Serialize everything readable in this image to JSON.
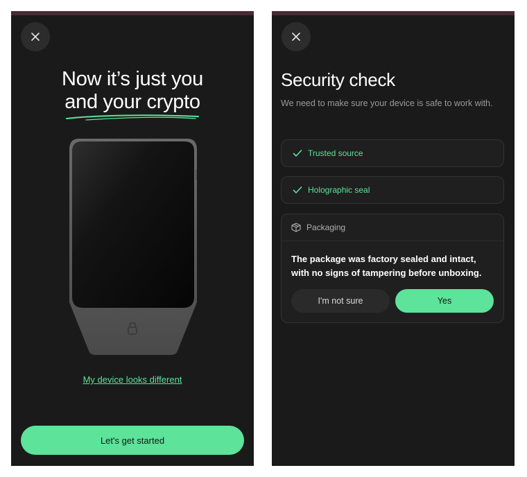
{
  "colors": {
    "accent": "#5de39a",
    "background": "#1a1a1a",
    "card": "#1f1f1f"
  },
  "welcome_screen": {
    "close_icon": "close-icon",
    "title_line1": "Now it’s just you",
    "title_line2": "and your crypto",
    "device_icon": "lock-icon",
    "link_label": "My device looks different",
    "primary_button_label": "Let's get started"
  },
  "security_screen": {
    "close_icon": "close-icon",
    "title": "Security check",
    "subtitle": "We need to make sure your device is safe to work with.",
    "checks": [
      {
        "label": "Trusted source",
        "icon": "checkmark-icon"
      },
      {
        "label": "Holographic seal",
        "icon": "checkmark-icon"
      }
    ],
    "packaging": {
      "icon": "package-icon",
      "header": "Packaging",
      "question": "The package was factory sealed and intact, with no signs of tampering before unboxing.",
      "secondary_button_label": "I'm not sure",
      "primary_button_label": "Yes"
    }
  }
}
